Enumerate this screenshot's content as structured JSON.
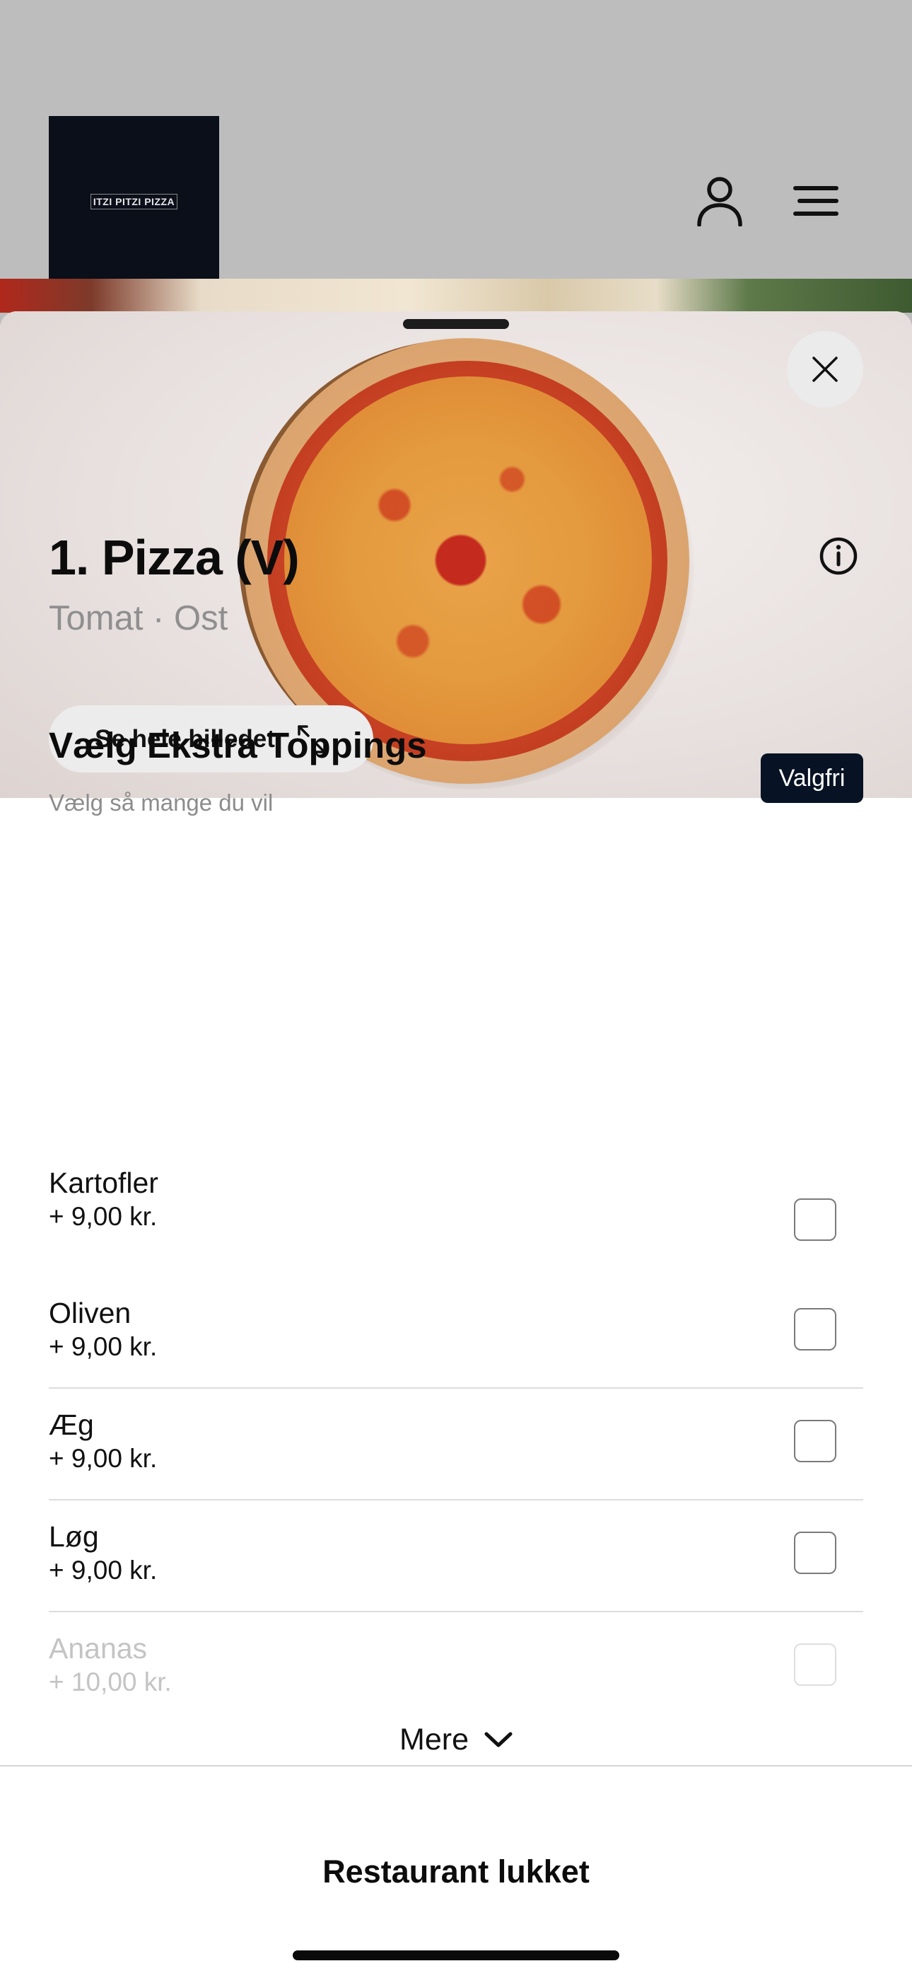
{
  "header": {
    "logo_text": "ITZI PITZI PIZZA",
    "user_icon": "user-icon",
    "menu_icon": "hamburger-menu-icon"
  },
  "sheet": {
    "close_icon": "close-icon",
    "see_full_image_label": "Se hele billedet",
    "expand_icon": "expand-arrows-icon"
  },
  "product": {
    "title": "1. Pizza (V)",
    "subtitle": "Tomat · Ost",
    "info_icon": "info-icon"
  },
  "toppings": {
    "title": "Vælg Ekstra Toppings",
    "subtitle": "Vælg så mange du vil",
    "badge": "Valgfri",
    "items": [
      {
        "name": "Kartofler",
        "price": "+ 9,00 kr.",
        "checked": false
      },
      {
        "name": "Oliven",
        "price": "+ 9,00 kr.",
        "checked": false
      },
      {
        "name": "Æg",
        "price": "+ 9,00 kr.",
        "checked": false
      },
      {
        "name": "Løg",
        "price": "+ 9,00 kr.",
        "checked": false
      },
      {
        "name": "Ananas",
        "price": "+ 10,00 kr.",
        "checked": false
      }
    ],
    "more_label": "Mere",
    "more_icon": "chevron-down-icon"
  },
  "footer": {
    "status_label": "Restaurant lukket"
  },
  "colors": {
    "header_bg": "#bdbdbd",
    "logo_bg": "#0a0f1a",
    "badge_bg": "#071224",
    "muted_text": "#8f8f8f"
  }
}
